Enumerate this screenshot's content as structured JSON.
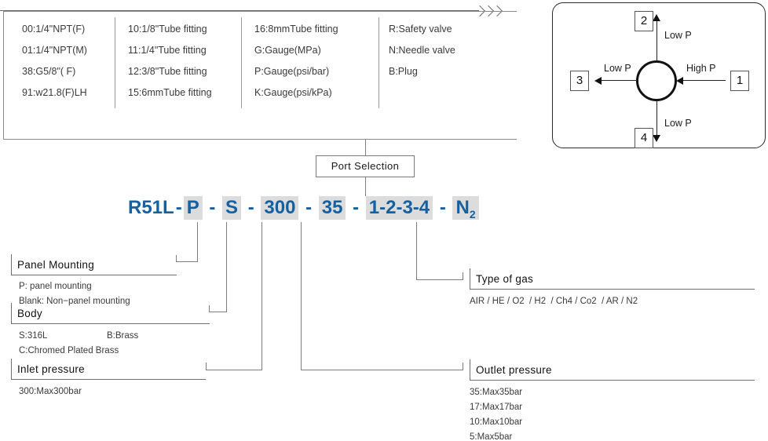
{
  "legend": {
    "columns": [
      {
        "name": "port-thread-column",
        "cells": [
          "00:1/4\"NPT(F)",
          "01:1/4\"NPT(M)",
          "38:G5/8\"( F)",
          "91:w21.8(F)LH"
        ]
      },
      {
        "name": "tube-fitting-column",
        "cells": [
          "10:1/8\"Tube fitting",
          "11:1/4\"Tube fitting",
          "12:3/8\"Tube fitting",
          "15:6mmTube fitting"
        ]
      },
      {
        "name": "gauge-column",
        "cells": [
          "16:8mmTube fitting",
          "G:Gauge(MPa)",
          "P:Gauge(psi/bar)",
          "K:Gauge(psi/kPa)"
        ]
      },
      {
        "name": "valve-column",
        "cells": [
          "R:Safety valve",
          "N:Needle valve",
          "B:Plug"
        ]
      }
    ]
  },
  "port_diagram": {
    "ports": [
      {
        "id": "port-1",
        "number": "1",
        "label": "High P"
      },
      {
        "id": "port-2",
        "number": "2",
        "label": "Low P"
      },
      {
        "id": "port-3",
        "number": "3",
        "label": "Low P"
      },
      {
        "id": "port-4",
        "number": "4",
        "label": "Low P"
      }
    ]
  },
  "port_selection": {
    "label": "Port Selection"
  },
  "part_code": {
    "accent_color": "#1560a0",
    "highlight_color": "#dcdcdc",
    "prefix": "R51L",
    "segments": [
      {
        "name": "panel-mounting-code",
        "value": "P",
        "highlighted": true
      },
      {
        "name": "body-code",
        "value": "S",
        "highlighted": true
      },
      {
        "name": "inlet-pressure-code",
        "value": "300",
        "highlighted": true
      },
      {
        "name": "outlet-pressure-code",
        "value": "35",
        "highlighted": true
      },
      {
        "name": "port-selection-code",
        "value": "1-2-3-4",
        "highlighted": true
      },
      {
        "name": "gas-type-code",
        "value": "N2",
        "highlighted": true
      }
    ],
    "full_text": "R51L-P-S-300-35-1-2-3-4-N2"
  },
  "annotations": {
    "panel_mounting": {
      "title": "Panel Mounting",
      "lines": [
        "P: panel mounting",
        "Blank: Non−panel mounting"
      ]
    },
    "body": {
      "title": "Body",
      "lines_row1_left": "S:316L",
      "lines_row1_right": "B:Brass",
      "lines_row2": "C:Chromed Plated Brass"
    },
    "inlet_pressure": {
      "title": "Inlet pressure",
      "lines": [
        "300:Max300bar"
      ]
    },
    "type_of_gas": {
      "title": "Type of gas",
      "lines": [
        "AIR / HE / O2  / H2  / Ch4 / Co2  / AR / N2"
      ]
    },
    "outlet_pressure": {
      "title": "Outlet pressure",
      "lines": [
        "35:Max35bar",
        "17:Max17bar",
        "10:Max10bar",
        "5:Max5bar"
      ]
    }
  }
}
